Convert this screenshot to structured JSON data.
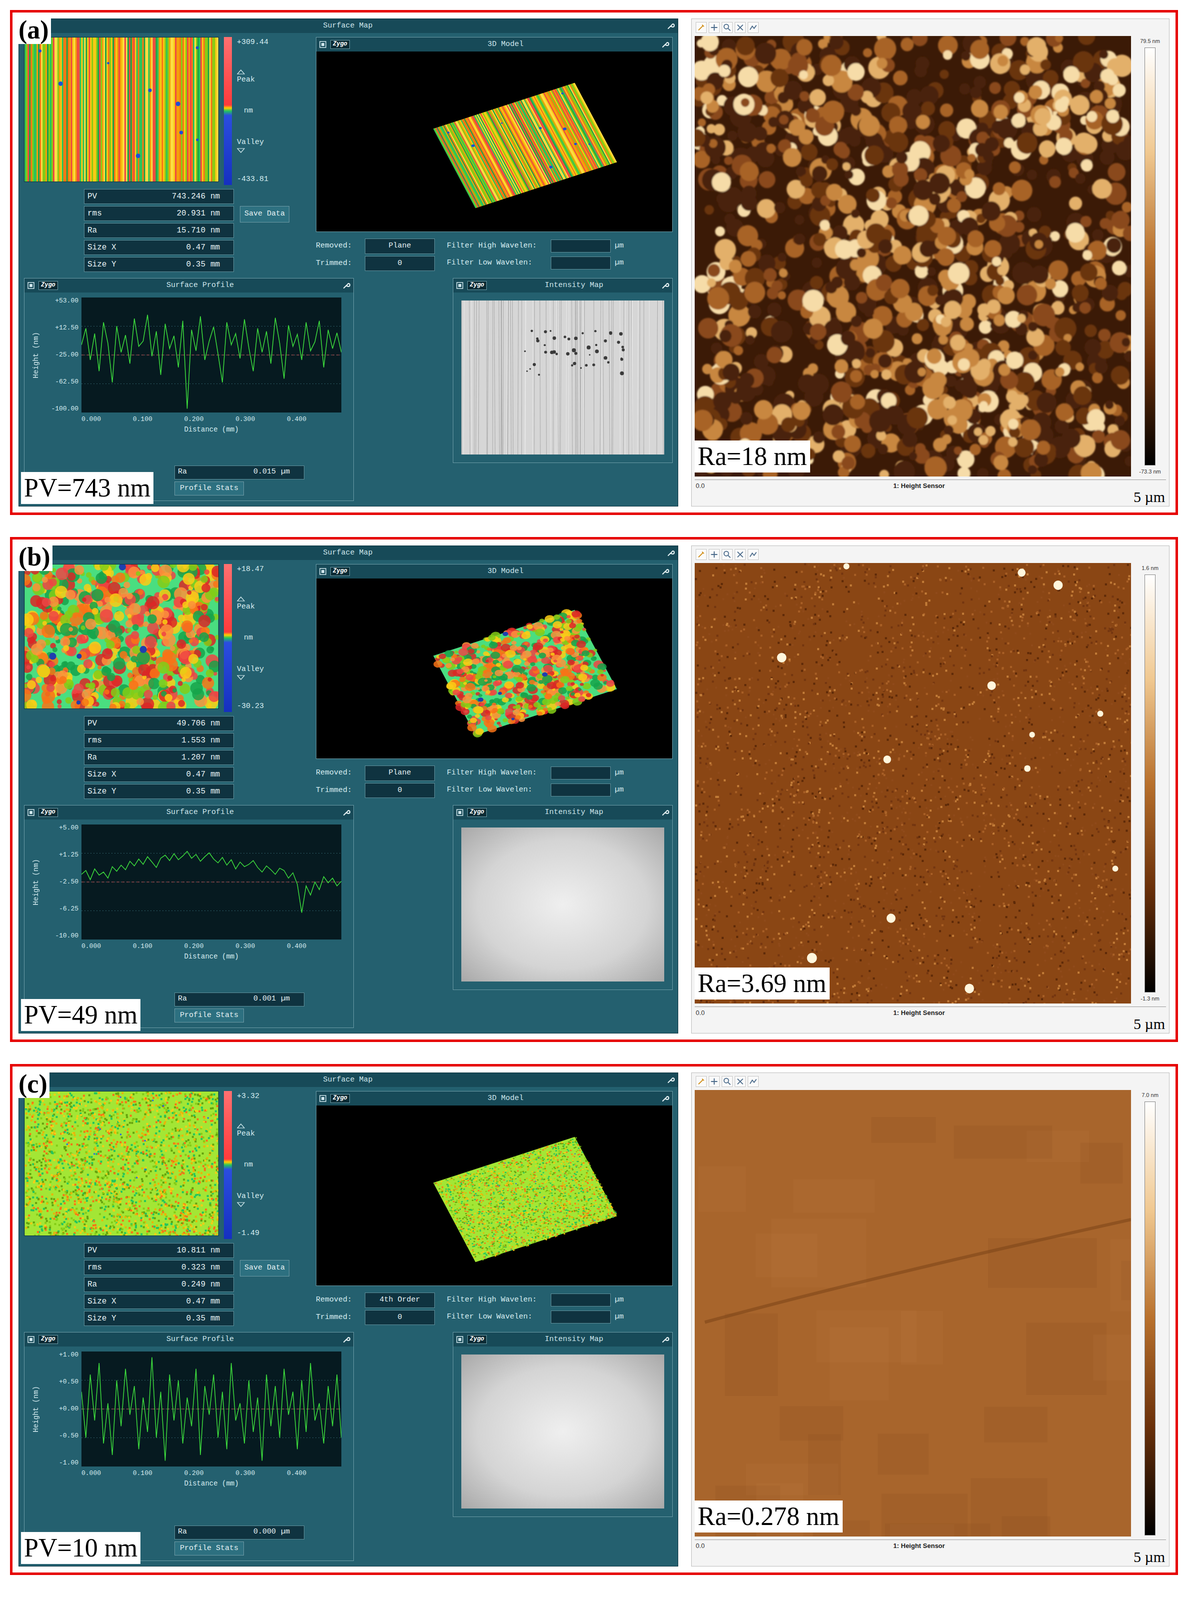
{
  "panels": [
    {
      "label": "(a)",
      "zygo": {
        "window_title": "Surface Map",
        "map": {
          "kind": "striped",
          "peak_value": "+309.44",
          "peak_label": "Peak",
          "unit": "nm",
          "valley_label": "Valley",
          "valley_value": "-433.81"
        },
        "stats": [
          {
            "name": "PV",
            "value": "743.246",
            "unit": "nm"
          },
          {
            "name": "rms",
            "value": "20.931",
            "unit": "nm"
          },
          {
            "name": "Ra",
            "value": "15.710",
            "unit": "nm"
          },
          {
            "name": "Size X",
            "value": "0.47",
            "unit": "mm"
          },
          {
            "name": "Size Y",
            "value": "0.35",
            "unit": "mm"
          }
        ],
        "save_button": "Save Data",
        "settings": [
          {
            "label": "Removed:",
            "value": "Plane"
          },
          {
            "label": "Trimmed:",
            "value": "0"
          }
        ],
        "filters": [
          {
            "label": "Filter High Wavelen:",
            "unit": "µm"
          },
          {
            "label": "Filter Low Wavelen:",
            "unit": "µm"
          }
        ],
        "model": {
          "title": "3D Model",
          "brand": "Zygo"
        },
        "profile": {
          "title": "Surface Profile",
          "brand": "Zygo",
          "y_ticks": [
            "+53.00",
            "+12.50",
            "-25.00",
            "-62.50",
            "-100.00"
          ],
          "x_ticks": [
            "0.000",
            "0.100",
            "0.200",
            "0.300",
            "0.400"
          ],
          "x_label": "Distance (mm)",
          "y_label": "Height (nm)",
          "y_range": [
            -100,
            53
          ],
          "values": [
            -10,
            12,
            -30,
            5,
            -45,
            20,
            -8,
            -60,
            15,
            -20,
            3,
            -35,
            25,
            -12,
            -5,
            30,
            -25,
            8,
            -50,
            18,
            -15,
            2,
            -40,
            22,
            -95,
            10,
            -18,
            28,
            -30,
            -5,
            14,
            -22,
            -60,
            20,
            -10,
            5,
            -28,
            24,
            -14,
            -45,
            12,
            -20,
            8,
            -35,
            26,
            -8,
            -55,
            16,
            -12,
            4,
            -30,
            20,
            -18,
            -6,
            22,
            -40,
            10,
            -15,
            6,
            -20
          ],
          "ra_label": "Ra",
          "ra_value": "0.015",
          "ra_unit": "µm",
          "stats_button": "Profile Stats"
        },
        "intensity": {
          "title": "Intensity Map",
          "brand": "Zygo",
          "kind": "scratched"
        },
        "pv_caption": "PV=743 nm"
      },
      "afm": {
        "kind": "grainy",
        "scale_max": "79.5 nm",
        "scale_min": "-73.3 nm",
        "axis_start": "0.0",
        "channel": "1: Height Sensor",
        "scale_bar": "5 µm",
        "ra_caption": "Ra=18 nm"
      }
    },
    {
      "label": "(b)",
      "zygo": {
        "window_title": "Surface Map",
        "map": {
          "kind": "mottled",
          "peak_value": "+18.47",
          "peak_label": "Peak",
          "unit": "nm",
          "valley_label": "Valley",
          "valley_value": "-30.23"
        },
        "stats": [
          {
            "name": "PV",
            "value": "49.706",
            "unit": "nm"
          },
          {
            "name": "rms",
            "value": "1.553",
            "unit": "nm"
          },
          {
            "name": "Ra",
            "value": "1.207",
            "unit": "nm"
          },
          {
            "name": "Size X",
            "value": "0.47",
            "unit": "mm"
          },
          {
            "name": "Size Y",
            "value": "0.35",
            "unit": "mm"
          }
        ],
        "settings": [
          {
            "label": "Removed:",
            "value": "Plane"
          },
          {
            "label": "Trimmed:",
            "value": "0"
          }
        ],
        "filters": [
          {
            "label": "Filter High Wavelen:",
            "unit": "µm"
          },
          {
            "label": "Filter Low Wavelen:",
            "unit": "µm"
          }
        ],
        "model": {
          "title": "3D Model",
          "brand": "Zygo"
        },
        "profile": {
          "title": "Surface Profile",
          "brand": "Zygo",
          "y_ticks": [
            "+5.00",
            "+1.25",
            "-2.50",
            "-6.25",
            "-10.00"
          ],
          "x_ticks": [
            "0.000",
            "0.100",
            "0.200",
            "0.300",
            "0.400"
          ],
          "x_label": "Distance (mm)",
          "y_label": "Height (nm)",
          "y_range": [
            -10,
            5
          ],
          "values": [
            -1.5,
            -1.0,
            -2.2,
            -0.8,
            -1.6,
            -1.2,
            -2.0,
            -0.5,
            -1.1,
            -0.3,
            -0.9,
            0.2,
            -0.4,
            0.5,
            -0.2,
            0.8,
            0.1,
            -0.6,
            0.6,
            1.0,
            0.3,
            1.2,
            0.4,
            0.9,
            1.5,
            0.6,
            1.1,
            0.2,
            0.8,
            1.3,
            0.5,
            0.0,
            0.7,
            -0.3,
            0.4,
            -0.8,
            0.1,
            -0.5,
            -0.2,
            0.3,
            -0.6,
            -1.2,
            -0.4,
            -0.9,
            -1.5,
            -0.7,
            -1.0,
            -2.0,
            -1.3,
            -2.8,
            -6.5,
            -3.0,
            -4.2,
            -2.5,
            -3.5,
            -1.8,
            -2.6,
            -2.0,
            -3.0,
            -2.4
          ],
          "ra_label": "Ra",
          "ra_value": "0.001",
          "ra_unit": "µm",
          "stats_button": "Profile Stats"
        },
        "intensity": {
          "title": "Intensity Map",
          "brand": "Zygo",
          "kind": "smooth"
        },
        "pv_caption": "PV=49 nm"
      },
      "afm": {
        "kind": "speckled",
        "scale_max": "1.6 nm",
        "scale_min": "-1.3 nm",
        "axis_start": "0.0",
        "channel": "1: Height Sensor",
        "scale_bar": "5 µm",
        "ra_caption": "Ra=3.69 nm"
      }
    },
    {
      "label": "(c)",
      "zygo": {
        "window_title": "Surface Map",
        "map": {
          "kind": "fine",
          "peak_value": "+3.32",
          "peak_label": "Peak",
          "unit": "nm",
          "valley_label": "Valley",
          "valley_value": "-1.49"
        },
        "stats": [
          {
            "name": "PV",
            "value": "10.811",
            "unit": "nm"
          },
          {
            "name": "rms",
            "value": "0.323",
            "unit": "nm"
          },
          {
            "name": "Ra",
            "value": "0.249",
            "unit": "nm"
          },
          {
            "name": "Size X",
            "value": "0.47",
            "unit": "mm"
          },
          {
            "name": "Size Y",
            "value": "0.35",
            "unit": "mm"
          }
        ],
        "save_button": "Save Data",
        "settings": [
          {
            "label": "Removed:",
            "value": "4th Order"
          },
          {
            "label": "Trimmed:",
            "value": "0"
          }
        ],
        "filters": [
          {
            "label": "Filter High Wavelen:",
            "unit": "µm"
          },
          {
            "label": "Filter Low Wavelen:",
            "unit": "µm"
          }
        ],
        "model": {
          "title": "3D Model",
          "brand": "Zygo"
        },
        "profile": {
          "title": "Surface Profile",
          "brand": "Zygo",
          "y_ticks": [
            "+1.00",
            "+0.50",
            "+0.00",
            "-0.50",
            "-1.00"
          ],
          "x_ticks": [
            "0.000",
            "0.100",
            "0.200",
            "0.300",
            "0.400"
          ],
          "x_label": "Distance (mm)",
          "y_label": "Height (nm)",
          "y_range": [
            -1,
            1
          ],
          "values": [
            0.3,
            -0.5,
            0.6,
            -0.2,
            0.8,
            -0.6,
            0.1,
            -0.8,
            0.5,
            -0.3,
            0.7,
            -0.1,
            0.4,
            -0.7,
            0.2,
            -0.4,
            0.9,
            -0.5,
            0.3,
            -0.9,
            0.6,
            -0.2,
            0.5,
            -0.6,
            0.2,
            -0.3,
            0.7,
            -0.8,
            0.4,
            -0.1,
            0.6,
            -0.5,
            0.3,
            -0.7,
            0.8,
            -0.2,
            0.1,
            -0.6,
            0.5,
            -0.4,
            0.2,
            -0.9,
            0.6,
            -0.3,
            0.4,
            -0.5,
            0.7,
            -0.1,
            0.3,
            -0.7,
            0.5,
            -0.4,
            0.8,
            -0.2,
            0.1,
            -0.6,
            0.4,
            -0.3,
            0.6,
            -0.5
          ],
          "ra_label": "Ra",
          "ra_value": "0.000",
          "ra_unit": "µm",
          "stats_button": "Profile Stats"
        },
        "intensity": {
          "title": "Intensity Map",
          "brand": "Zygo",
          "kind": "smooth"
        },
        "pv_caption": "PV=10 nm"
      },
      "afm": {
        "kind": "smooth",
        "scale_max": "7.0 nm",
        "axis_start": "0.0",
        "channel": "1: Height Sensor",
        "scale_bar": "5 µm",
        "ra_caption": "Ra=0.278 nm"
      }
    }
  ]
}
